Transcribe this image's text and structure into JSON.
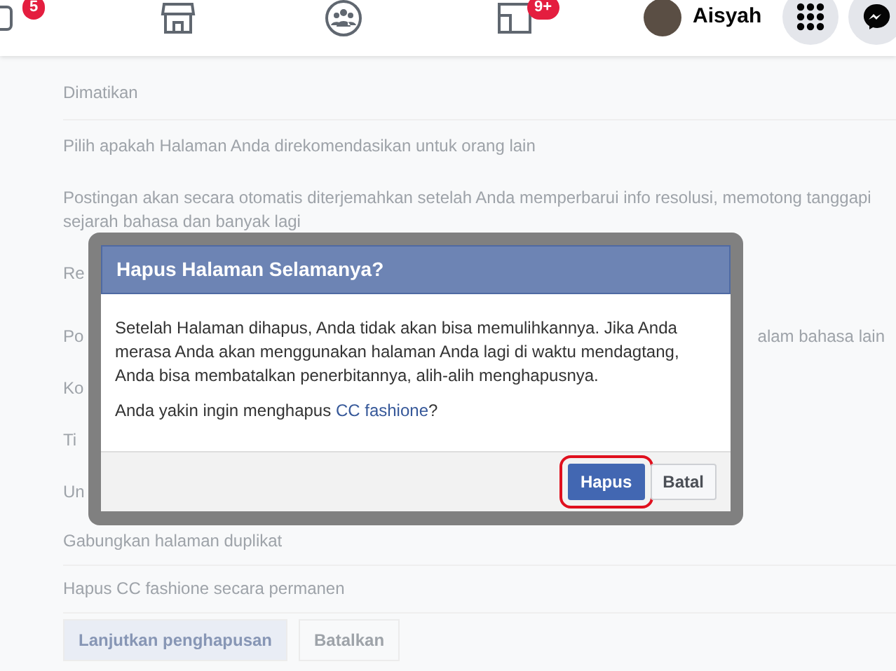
{
  "topbar": {
    "nav_items": [
      {
        "kind": "video",
        "badge": "5"
      },
      {
        "kind": "store"
      },
      {
        "kind": "groups"
      },
      {
        "kind": "gaming",
        "badge": "9+"
      }
    ],
    "profile": {
      "name": "Aisyah"
    },
    "actions": [
      {
        "kind": "menu"
      },
      {
        "kind": "messenger"
      }
    ]
  },
  "settings": {
    "rows": [
      {
        "text": "Dimatikan",
        "divider": true
      },
      {
        "text": "Pilih apakah Halaman Anda direkomendasikan untuk orang lain"
      },
      {
        "text": "Postingan akan secara otomatis diterjemahkan setelah Anda memperbarui info resolusi, memotong tanggapi sejarah bahasa dan banyak lagi"
      },
      {
        "text": "Re"
      },
      {
        "text": "Po",
        "right": "alam bahasa lain"
      },
      {
        "text": "Ko"
      },
      {
        "text": "Ti"
      },
      {
        "text": "Un"
      },
      {
        "text": "Gabungkan halaman duplikat",
        "divider": true
      },
      {
        "text": "Hapus CC fashione secara permanen",
        "divider": true
      }
    ],
    "buttons": [
      {
        "label": "Lanjutkan penghapusan",
        "kind": "primary"
      },
      {
        "label": "Batalkan",
        "kind": "secondary"
      }
    ]
  },
  "dialog": {
    "title": "Hapus Halaman Selamanya?",
    "message": "Setelah Halaman dihapus, Anda tidak akan bisa memulihkannya. Jika Anda merasa Anda akan menggunakan halaman Anda lagi di waktu mendagtang, Anda bisa membatalkan penerbitannya, alih-alih menghapusnya.",
    "question_prefix": "Anda yakin ingin menghapus ",
    "question_link": "CC fashione",
    "question_suffix": "?",
    "buttons": [
      {
        "label": "Hapus",
        "kind": "primary",
        "highlighted": true
      },
      {
        "label": "Batal",
        "kind": "secondary",
        "highlighted": false
      }
    ]
  }
}
